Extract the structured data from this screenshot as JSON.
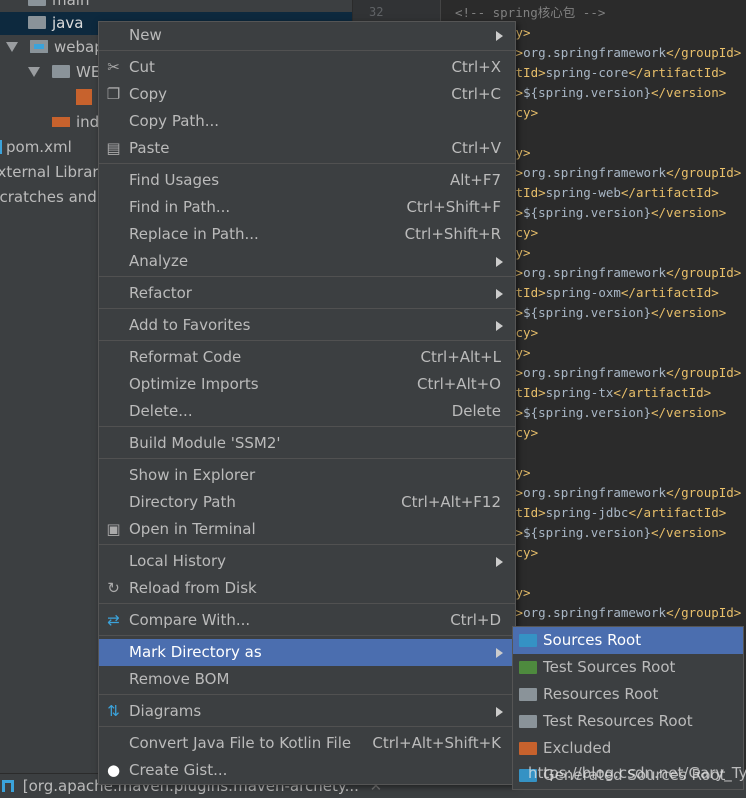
{
  "tree": {
    "items": [
      {
        "label": "main"
      },
      {
        "label": "java"
      },
      {
        "label": "webapp"
      },
      {
        "label": "WEB-INF"
      },
      {
        "label": ""
      },
      {
        "label": "index.jsp"
      },
      {
        "label": "pom.xml"
      },
      {
        "label": "External Libraries"
      },
      {
        "label": "Scratches and Consoles"
      }
    ]
  },
  "gutter": {
    "line_number": "32"
  },
  "editor": {
    "lines": [
      "<!-- spring核心包 -->",
      "cy>",
      "d>org.springframework</groupId>",
      "ctId>spring-core</artifactId>",
      "n>${spring.version}</version>",
      "ncy>",
      "",
      "cy>",
      "d>org.springframework</groupId>",
      "ctId>spring-web</artifactId>",
      "n>${spring.version}</version>",
      "ncy>",
      "cy>",
      "d>org.springframework</groupId>",
      "ctId>spring-oxm</artifactId>",
      "n>${spring.version}</version>",
      "ncy>",
      "cy>",
      "d>org.springframework</groupId>",
      "ctId>spring-tx</artifactId>",
      "n>${spring.version}</version>",
      "ncy>",
      "",
      "cy>",
      "d>org.springframework</groupId>",
      "ctId>spring-jdbc</artifactId>",
      "n>${spring.version}</version>",
      "ncy>",
      "",
      "cy>",
      "d>org.springframework</groupId>"
    ]
  },
  "menu": {
    "groups": [
      [
        {
          "label": "New",
          "submenu": true
        }
      ],
      [
        {
          "label": "Cut",
          "shortcut": "Ctrl+X",
          "icon": "scissors-icon"
        },
        {
          "label": "Copy",
          "shortcut": "Ctrl+C",
          "icon": "copy-icon"
        },
        {
          "label": "Copy Path...",
          "shortcut": ""
        },
        {
          "label": "Paste",
          "shortcut": "Ctrl+V",
          "icon": "clipboard-icon"
        }
      ],
      [
        {
          "label": "Find Usages",
          "shortcut": "Alt+F7"
        },
        {
          "label": "Find in Path...",
          "shortcut": "Ctrl+Shift+F"
        },
        {
          "label": "Replace in Path...",
          "shortcut": "Ctrl+Shift+R"
        },
        {
          "label": "Analyze",
          "submenu": true
        }
      ],
      [
        {
          "label": "Refactor",
          "submenu": true
        }
      ],
      [
        {
          "label": "Add to Favorites",
          "submenu": true
        }
      ],
      [
        {
          "label": "Reformat Code",
          "shortcut": "Ctrl+Alt+L"
        },
        {
          "label": "Optimize Imports",
          "shortcut": "Ctrl+Alt+O"
        },
        {
          "label": "Delete...",
          "shortcut": "Delete"
        }
      ],
      [
        {
          "label": "Build Module 'SSM2'"
        }
      ],
      [
        {
          "label": "Show in Explorer"
        },
        {
          "label": "Directory Path",
          "shortcut": "Ctrl+Alt+F12"
        },
        {
          "label": "Open in Terminal",
          "icon": "terminal-icon"
        }
      ],
      [
        {
          "label": "Local History",
          "submenu": true
        },
        {
          "label": "Reload from Disk",
          "icon": "reload-icon"
        }
      ],
      [
        {
          "label": "Compare With...",
          "shortcut": "Ctrl+D",
          "icon": "compare-icon"
        }
      ],
      [
        {
          "label": "Mark Directory as",
          "submenu": true,
          "highlighted": true
        },
        {
          "label": "Remove BOM"
        }
      ],
      [
        {
          "label": "Diagrams",
          "submenu": true,
          "icon": "diagram-icon"
        }
      ],
      [
        {
          "label": "Convert Java File to Kotlin File",
          "shortcut": "Ctrl+Alt+Shift+K"
        },
        {
          "label": "Create Gist...",
          "icon": "github-icon"
        }
      ]
    ]
  },
  "submenu": {
    "items": [
      {
        "label": "Sources Root",
        "color": "#3592c4",
        "highlighted": true
      },
      {
        "label": "Test Sources Root",
        "color": "#4e8a3e"
      },
      {
        "label": "Resources Root",
        "color": "#8a9399"
      },
      {
        "label": "Test Resources Root",
        "color": "#8a9399"
      },
      {
        "label": "Excluded",
        "color": "#c7622d"
      },
      {
        "label": "Generated Sources Root",
        "color": "#3592c4"
      }
    ]
  },
  "bottom": {
    "tab_label": "[org.apache.maven.plugins:maven-archety..."
  },
  "watermark": "https://blog.csdn.net/Gary_Tyy"
}
